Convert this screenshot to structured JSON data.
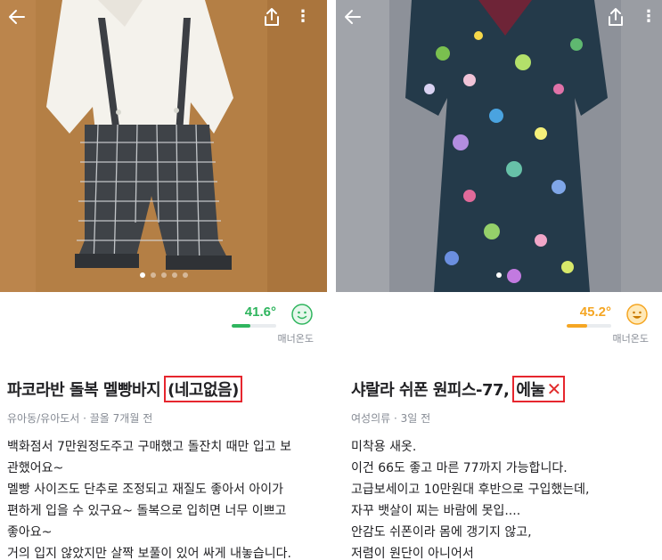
{
  "left": {
    "temperature": {
      "value": "41.6°",
      "label": "매너온도",
      "level": 0.42,
      "color": "#2fb55e"
    },
    "title_main": "파코라반 돌복 멜빵바지",
    "title_highlight": "(네고없음)",
    "meta": "유아동/유아도서 · 끌올 7개월 전",
    "description": [
      "백화점서 7만원정도주고 구매했고 돌잔치 때만 입고 보",
      "관했어요~",
      "멜빵 사이즈도 단추로 조정되고 재질도 좋아서 아이가",
      "편하게 입을 수 있구요~  돌복으로 입히면 너무 이쁘고",
      "좋아요~",
      "거의 입지 않았지만 살짝 보풀이 있어 싸게 내놓습니다."
    ],
    "images_count": 5,
    "active_image": 0
  },
  "right": {
    "temperature": {
      "value": "45.2°",
      "label": "매너온도",
      "level": 0.45,
      "color": "#f5a623"
    },
    "title_main": "샤랄라 쉬폰 원피스-77,",
    "title_highlight": "에눌",
    "meta": "여성의류 · 3일 전",
    "description": [
      "미착용 새옷.",
      "이건 66도 좋고 마른 77까지 가능합니다.",
      "고급보세이고 10만원대 후반으로 구입했는데,",
      "자꾸 뱃살이 찌는 바람에 못입....",
      "안감도 쉬폰이라 몸에 갱기지 않고,",
      "저렴이 원단이 아니어서"
    ],
    "images_count": 1,
    "active_image": 0
  },
  "icons": {
    "back": "back-arrow-icon",
    "share": "share-icon",
    "more": "more-vertical-icon",
    "face": "smile-face-icon",
    "x": "red-x-icon"
  }
}
